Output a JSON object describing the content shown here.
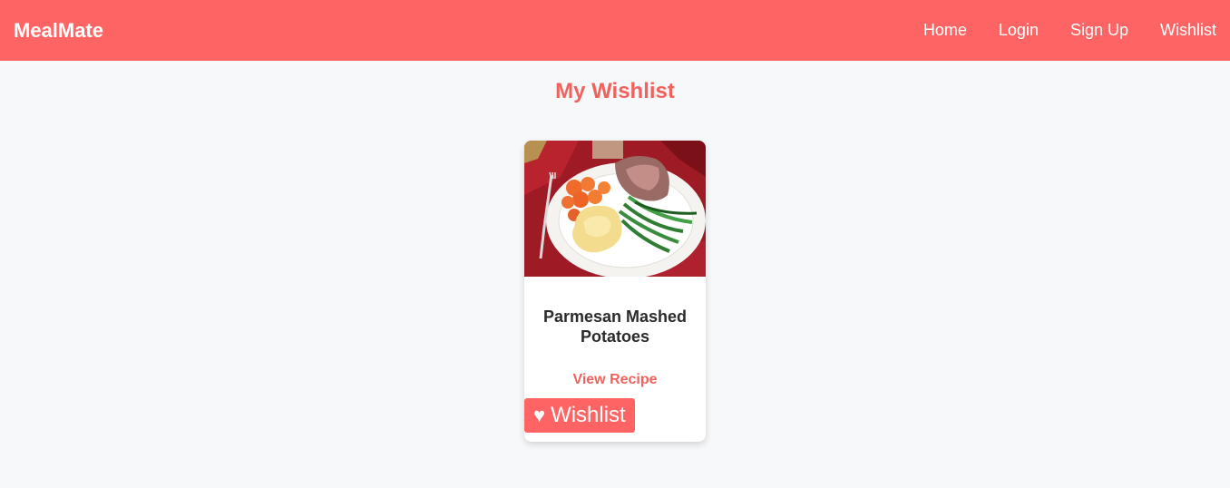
{
  "navbar": {
    "brand": "MealMate",
    "links": [
      {
        "label": "Home"
      },
      {
        "label": "Login"
      },
      {
        "label": "Sign Up"
      },
      {
        "label": "Wishlist"
      }
    ]
  },
  "main": {
    "title": "My Wishlist",
    "cards": [
      {
        "image_icon": "food-photo",
        "title": "Parmesan Mashed Potatoes",
        "view_label": "View Recipe",
        "wishlist_icon": "heart-icon",
        "wishlist_label": "Wishlist"
      }
    ]
  },
  "colors": {
    "accent": "#ff6464",
    "title": "#f0625e",
    "background": "#f7f8fa"
  }
}
